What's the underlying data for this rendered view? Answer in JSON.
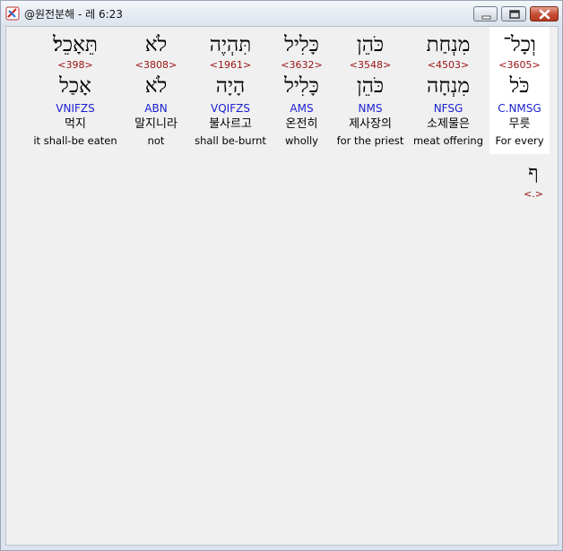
{
  "window": {
    "title": "@원전분해 - 레 6:23"
  },
  "columns": [
    {
      "heb": "תֵּאָכֵל׃",
      "strong": "<398>",
      "lemma": "אָכַל",
      "morph": "VNIFZS",
      "kor": "먹지",
      "eng": "it shall-be eaten",
      "selected": false
    },
    {
      "heb": "לֹא",
      "strong": "<3808>",
      "lemma": "לֹא",
      "morph": "ABN",
      "kor": "말지니라",
      "eng": "not",
      "selected": false
    },
    {
      "heb": "תִּהְיֶה",
      "strong": "<1961>",
      "lemma": "הָיָה",
      "morph": "VQIFZS",
      "kor": "불사르고",
      "eng": "shall be-burnt",
      "selected": false
    },
    {
      "heb": "כָּלִיל",
      "strong": "<3632>",
      "lemma": "כָּלִיל",
      "morph": "AMS",
      "kor": "온전히",
      "eng": "wholly",
      "selected": false
    },
    {
      "heb": "כֹּהֵן",
      "strong": "<3548>",
      "lemma": "כֹּהֵן",
      "morph": "NMS",
      "kor": "제사장의",
      "eng": "for the priest",
      "selected": false
    },
    {
      "heb": "מִנְחַת",
      "strong": "<4503>",
      "lemma": "מִנְחָה",
      "morph": "NFSG",
      "kor": "소제물은",
      "eng": "meat offering",
      "selected": false
    },
    {
      "heb": "וְכָל־",
      "strong": "<3605>",
      "lemma": "כֹּל",
      "morph": "C.NMSG",
      "kor": "무릇",
      "eng": "For every",
      "selected": true
    }
  ],
  "punctuation": {
    "heb": "ף",
    "strong": "<.>"
  }
}
